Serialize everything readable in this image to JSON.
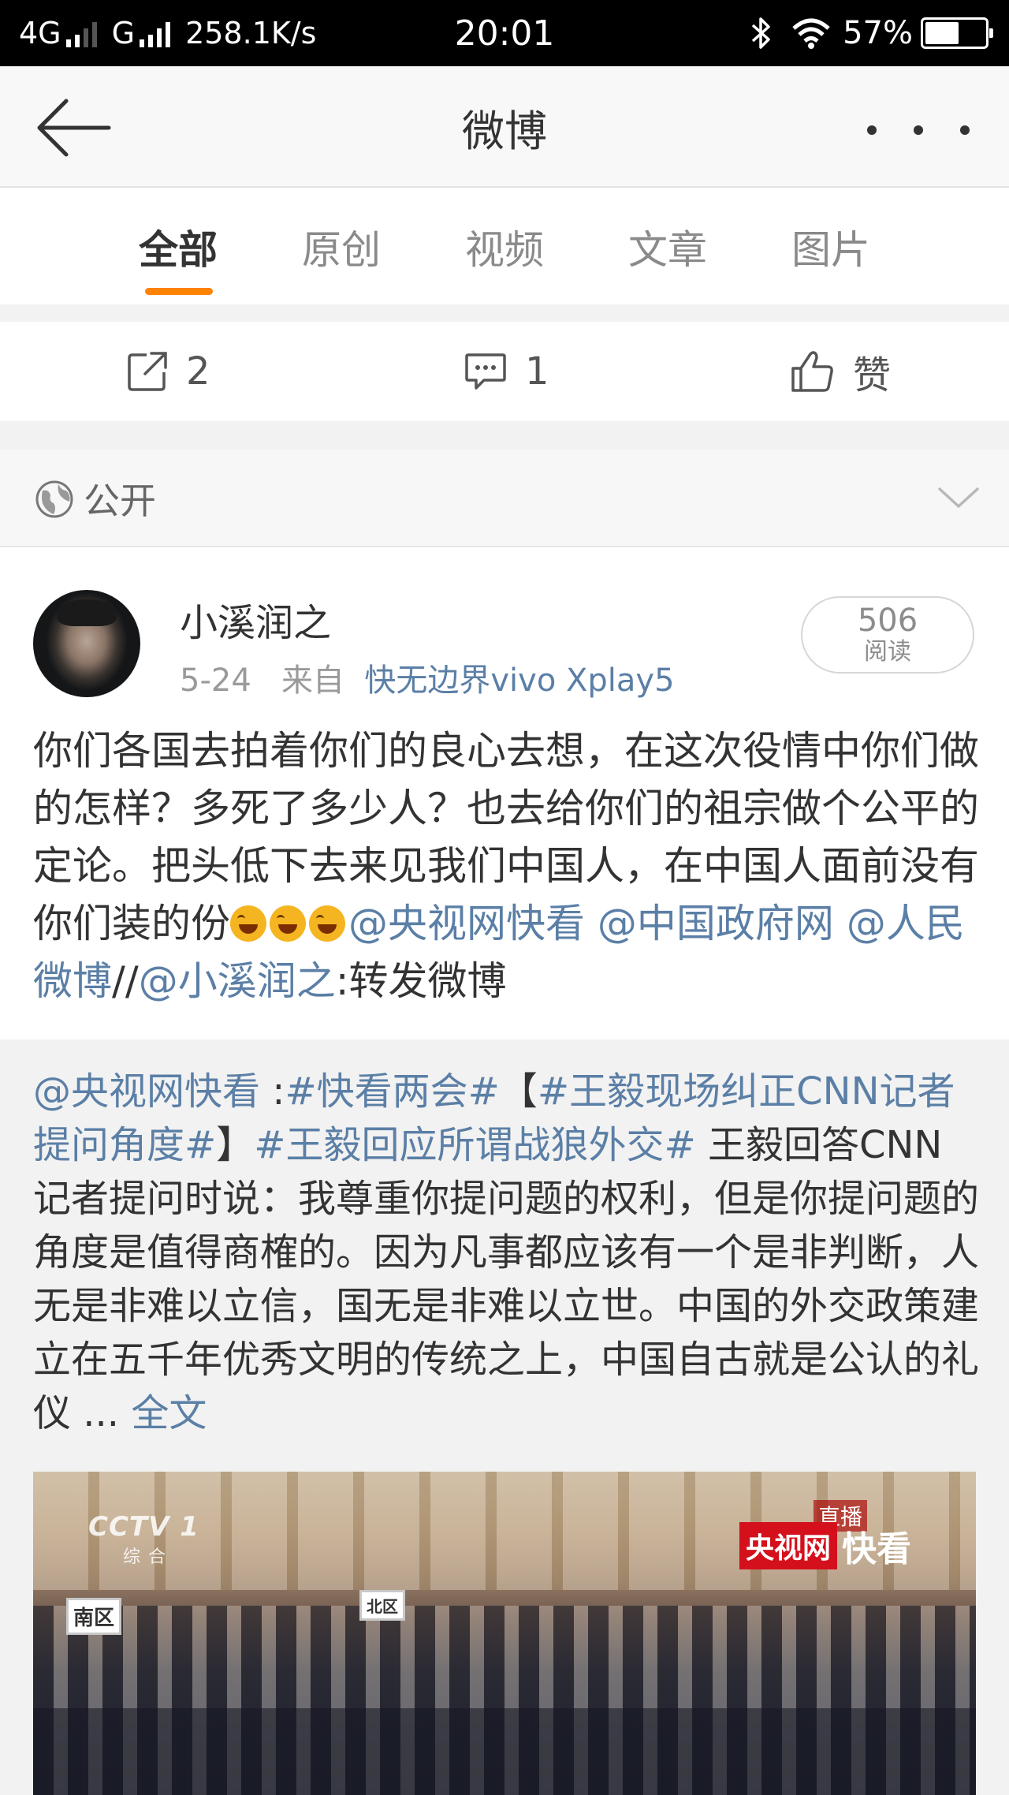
{
  "status_bar": {
    "network_left": "4G",
    "network_right": "G",
    "speed": "258.1K/s",
    "time": "20:01",
    "battery": "57%",
    "battery_level": 0.57
  },
  "header": {
    "title": "微博"
  },
  "tabs": [
    {
      "label": "全部",
      "active": true
    },
    {
      "label": "原创",
      "active": false
    },
    {
      "label": "视频",
      "active": false
    },
    {
      "label": "文章",
      "active": false
    },
    {
      "label": "图片",
      "active": false
    }
  ],
  "colors": {
    "accent": "#ff8200",
    "link": "#5b7fa6",
    "status_bar": "#000000"
  },
  "actions": {
    "repost_count": "2",
    "comment_count": "1",
    "like_label": "赞"
  },
  "visibility": {
    "label": "公开"
  },
  "post": {
    "username": "小溪润之",
    "date": "5-24",
    "from_label": "来自",
    "source": "快无边界vivo Xplay5",
    "read_count": "506",
    "read_label": "阅读",
    "text_main": "你们各国去拍着你们的良心去想，在这次役情中你们做的怎样？多死了多少人？也去给你们的祖宗做个公平的定论。把头低下去来见我们中国人，在中国人面前没有你们装的份",
    "mention_1": "@央视网快看",
    "mention_2": "@中国政府网",
    "mention_3": "@人民微博",
    "separator": "//",
    "mention_self": "@小溪润之",
    "repost_suffix": ":转发微博"
  },
  "repost": {
    "author": "@央视网快看",
    "colon": " :",
    "topic_1": "#快看两会#",
    "bracket_open": "【",
    "topic_2": "#王毅现场纠正CNN记者提问角度#",
    "bracket_close": "】",
    "topic_3": "#王毅回应所谓战狼外交#",
    "body": " 王毅回答CNN记者提问时说：我尊重你提问题的权利，但是你提问题的角度是值得商榷的。因为凡事都应该有一个是非判断，人无是非难以立信，国无是非难以立世。中国的外交政策建立在五千年优秀文明的传统之上，中国自古就是公认的礼仪 ...",
    "full_text_link": "全文"
  },
  "media": {
    "channel_logo": "CCTV 1",
    "channel_sub": "综合",
    "live_tag": "直播",
    "brand_red": "央视网",
    "brand_white": "快看",
    "sign_left": "南区",
    "sign_mid": "北区"
  }
}
